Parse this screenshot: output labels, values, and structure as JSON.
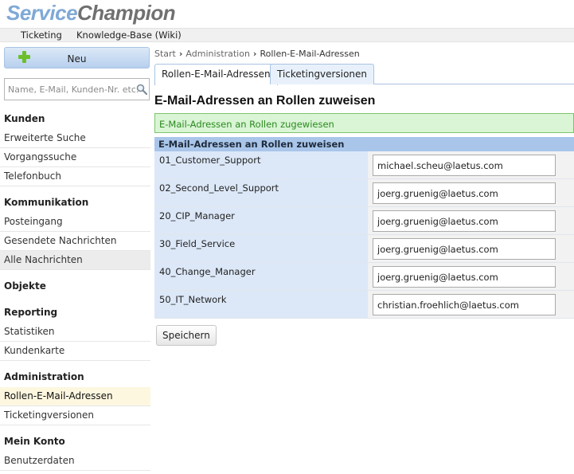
{
  "logo": {
    "part1": "Service",
    "part2": "Champion"
  },
  "menubar": {
    "items": [
      "Ticketing",
      "Knowledge-Base (Wiki)"
    ]
  },
  "sidebar": {
    "new_button": "Neu",
    "search_placeholder": "Name, E-Mail, Kunden-Nr. etc.",
    "sections": [
      {
        "heading": "Kunden",
        "items": [
          "Erweiterte Suche",
          "Vorgangssuche",
          "Telefonbuch"
        ]
      },
      {
        "heading": "Kommunikation",
        "items": [
          "Posteingang",
          "Gesendete Nachrichten",
          "Alle Nachrichten"
        ]
      },
      {
        "heading": "Objekte",
        "items": []
      },
      {
        "heading": "Reporting",
        "items": [
          "Statistiken",
          "Kundenkarte"
        ]
      },
      {
        "heading": "Administration",
        "items": [
          "Rollen-E-Mail-Adressen",
          "Ticketingversionen"
        ]
      },
      {
        "heading": "Mein Konto",
        "items": [
          "Benutzerdaten"
        ]
      }
    ]
  },
  "breadcrumb": [
    "Start",
    "Administration",
    "Rollen-E-Mail-Adressen"
  ],
  "tabs": [
    "Rollen-E-Mail-Adressen",
    "Ticketingversionen"
  ],
  "page_title": "E-Mail-Adressen an Rollen zuweisen",
  "success_message": "E-Mail-Adressen an Rollen zugewiesen",
  "panel": {
    "heading": "E-Mail-Adressen an Rollen zuweisen",
    "rows": [
      {
        "role": "01_Customer_Support",
        "email": "michael.scheu@laetus.com"
      },
      {
        "role": "02_Second_Level_Support",
        "email": "joerg.gruenig@laetus.com"
      },
      {
        "role": "20_CIP_Manager",
        "email": "joerg.gruenig@laetus.com"
      },
      {
        "role": "30_Field_Service",
        "email": "joerg.gruenig@laetus.com"
      },
      {
        "role": "40_Change_Manager",
        "email": "joerg.gruenig@laetus.com"
      },
      {
        "role": "50_IT_Network",
        "email": "christian.froehlich@laetus.com"
      }
    ]
  },
  "save_button": "Speichern",
  "colors": {
    "accent": "#a9c6ea",
    "success_bg": "#d9f5d5",
    "success_text": "#2b8a1f",
    "active_item": "#fdf7e0"
  }
}
